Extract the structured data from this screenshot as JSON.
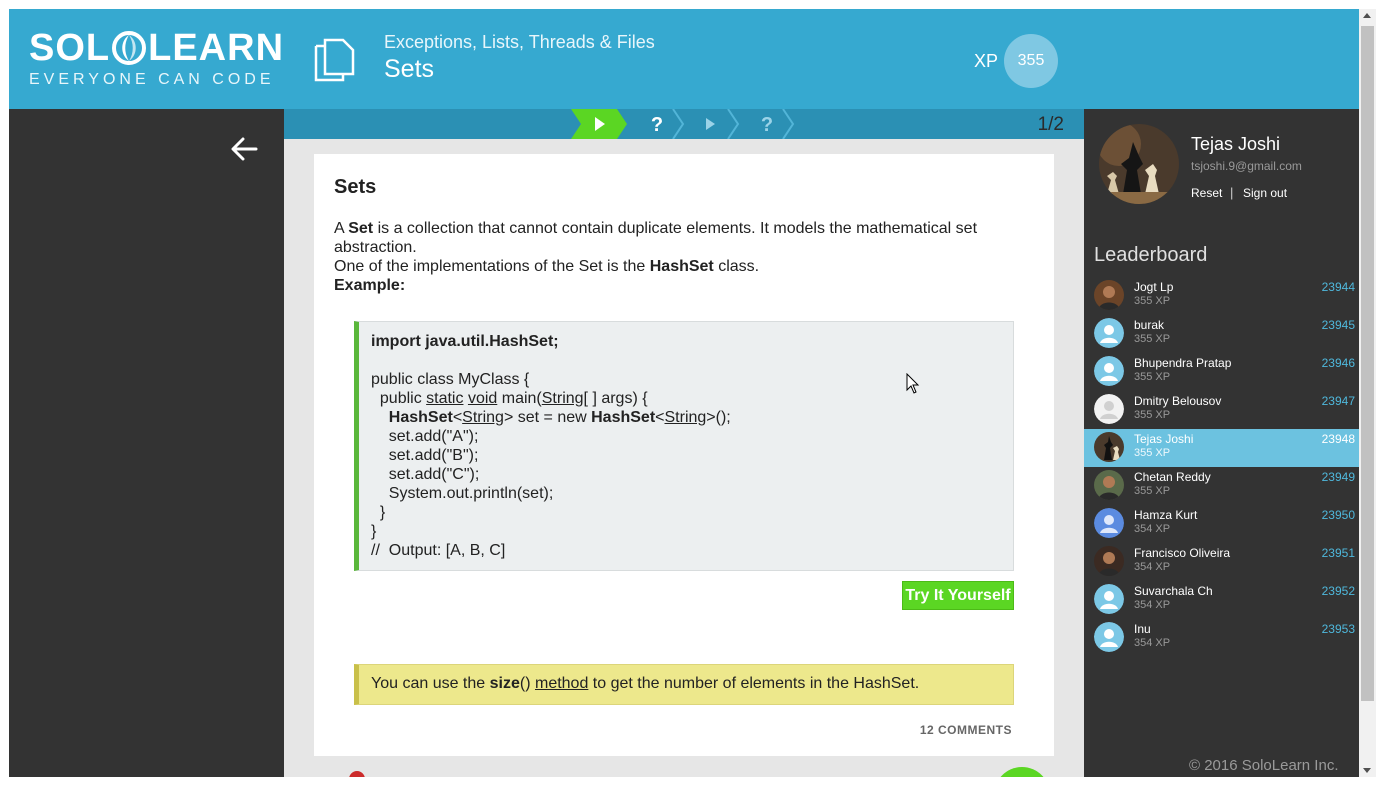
{
  "header": {
    "logo_left": "SOL",
    "logo_right": "LEARN",
    "logo_tagline": "EVERYONE CAN CODE",
    "course_name": "Exceptions, Lists, Threads & Files",
    "lesson_title": "Sets",
    "xp_label": "XP",
    "xp_value": "355"
  },
  "progress": {
    "steps": [
      {
        "icon": "play-icon",
        "state": "active"
      },
      {
        "icon": "question-icon",
        "state": "pending"
      },
      {
        "icon": "play-icon",
        "state": "pending"
      },
      {
        "icon": "question-icon",
        "state": "pending"
      }
    ],
    "count": "1/2"
  },
  "card": {
    "title": "Sets",
    "p1_a": "A ",
    "p1_b": "Set",
    "p1_c": " is a collection that cannot contain duplicate elements. It models the mathematical set abstraction.",
    "p2_a": "One of the implementations of the Set is the ",
    "p2_b": "HashSet",
    "p2_c": " class.",
    "p3": "Example:",
    "code": {
      "l1": "import java.util.HashSet;",
      "l3": "public class MyClass {",
      "l4a": "  public ",
      "l4_static": "static",
      "l4_void": "void",
      "l4_main": " main(",
      "l4_string": "String",
      "l4_end": "[ ] args) {",
      "l5_indent": "    ",
      "l5_hashset": "HashSet",
      "l5_lt": "<",
      "l5_string": "String",
      "l5_mid": "> set = new ",
      "l5_hashset2": "HashSet",
      "l5_lt2": "<",
      "l5_string2": "String",
      "l5_end": ">();",
      "l6": "    set.add(\"A\");",
      "l7": "    set.add(\"B\");",
      "l8": "    set.add(\"C\");",
      "l9": "    System.out.println(set);",
      "l10": "  }",
      "l11": "}",
      "l12": "//  Output: [A, B, C]"
    },
    "try_button": "Try It Yourself",
    "tip_a": "You can use the ",
    "tip_b": "size",
    "tip_c": "() ",
    "tip_d": "method",
    "tip_e": " to get the number of elements in the HashSet.",
    "comments": "12 COMMENTS"
  },
  "profile": {
    "name": "Tejas Joshi",
    "email": "tsjoshi.9@gmail.com",
    "reset": "Reset",
    "separator": "|",
    "signout": "Sign out"
  },
  "leaderboard": {
    "title": "Leaderboard",
    "rows": [
      {
        "name": "Jogt Lp",
        "xp": "355 XP",
        "rank": "23944",
        "avatar": "photo"
      },
      {
        "name": "burak",
        "xp": "355 XP",
        "rank": "23945",
        "avatar": "default"
      },
      {
        "name": "Bhupendra Pratap",
        "xp": "355 XP",
        "rank": "23946",
        "avatar": "default"
      },
      {
        "name": "Dmitry Belousov",
        "xp": "355 XP",
        "rank": "23947",
        "avatar": "grey"
      },
      {
        "name": "Tejas Joshi",
        "xp": "355 XP",
        "rank": "23948",
        "avatar": "chess"
      },
      {
        "name": "Chetan Reddy",
        "xp": "355 XP",
        "rank": "23949",
        "avatar": "photo"
      },
      {
        "name": "Hamza Kurt",
        "xp": "354 XP",
        "rank": "23950",
        "avatar": "blue"
      },
      {
        "name": "Francisco Oliveira",
        "xp": "354 XP",
        "rank": "23951",
        "avatar": "photo"
      },
      {
        "name": "Suvarchala Ch",
        "xp": "354 XP",
        "rank": "23952",
        "avatar": "default"
      },
      {
        "name": "Inu",
        "xp": "354 XP",
        "rank": "23953",
        "avatar": "default"
      }
    ]
  },
  "footer": {
    "copyright": "© 2016 SoloLearn Inc."
  },
  "colors": {
    "header": "#36a9d0",
    "sidebar": "#333333",
    "accent_green": "#5bd623",
    "highlight_row": "#6cc2e0"
  }
}
